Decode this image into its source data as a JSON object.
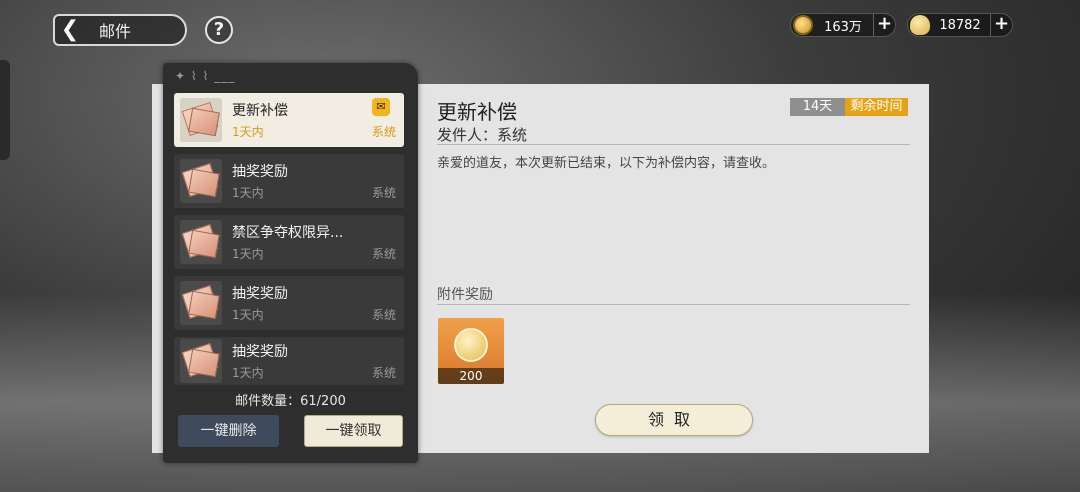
{
  "header": {
    "back_icon": "chevron-left-icon",
    "title": "邮件",
    "help_label": "?"
  },
  "resources": [
    {
      "icon": "coin-icon",
      "value": "163万"
    },
    {
      "icon": "key-icon",
      "value": "18782"
    }
  ],
  "mail_list": {
    "items": [
      {
        "title": "更新补偿",
        "time": "1天内",
        "sender": "系统",
        "selected": true,
        "has_attachment": true
      },
      {
        "title": "抽奖奖励",
        "time": "1天内",
        "sender": "系统",
        "selected": false,
        "has_attachment": false
      },
      {
        "title": "禁区争夺权限异...",
        "time": "1天内",
        "sender": "系统",
        "selected": false,
        "has_attachment": false
      },
      {
        "title": "抽奖奖励",
        "time": "1天内",
        "sender": "系统",
        "selected": false,
        "has_attachment": false
      },
      {
        "title": "抽奖奖励",
        "time": "1天内",
        "sender": "系统",
        "selected": false,
        "has_attachment": false
      }
    ],
    "count_text": "邮件数量：61/200",
    "delete_all_label": "一键删除",
    "claim_all_label": "一键领取"
  },
  "detail": {
    "title": "更新补偿",
    "expire_days": "14天",
    "expire_label": "剩余时间",
    "sender_line": "发件人：系统",
    "body": "亲爱的道友，本次更新已结束，以下为补偿内容，请查收。",
    "attachment_label": "附件奖励",
    "attachments": [
      {
        "icon": "golden-token-icon",
        "quantity": "200"
      }
    ],
    "claim_label": "领取"
  }
}
